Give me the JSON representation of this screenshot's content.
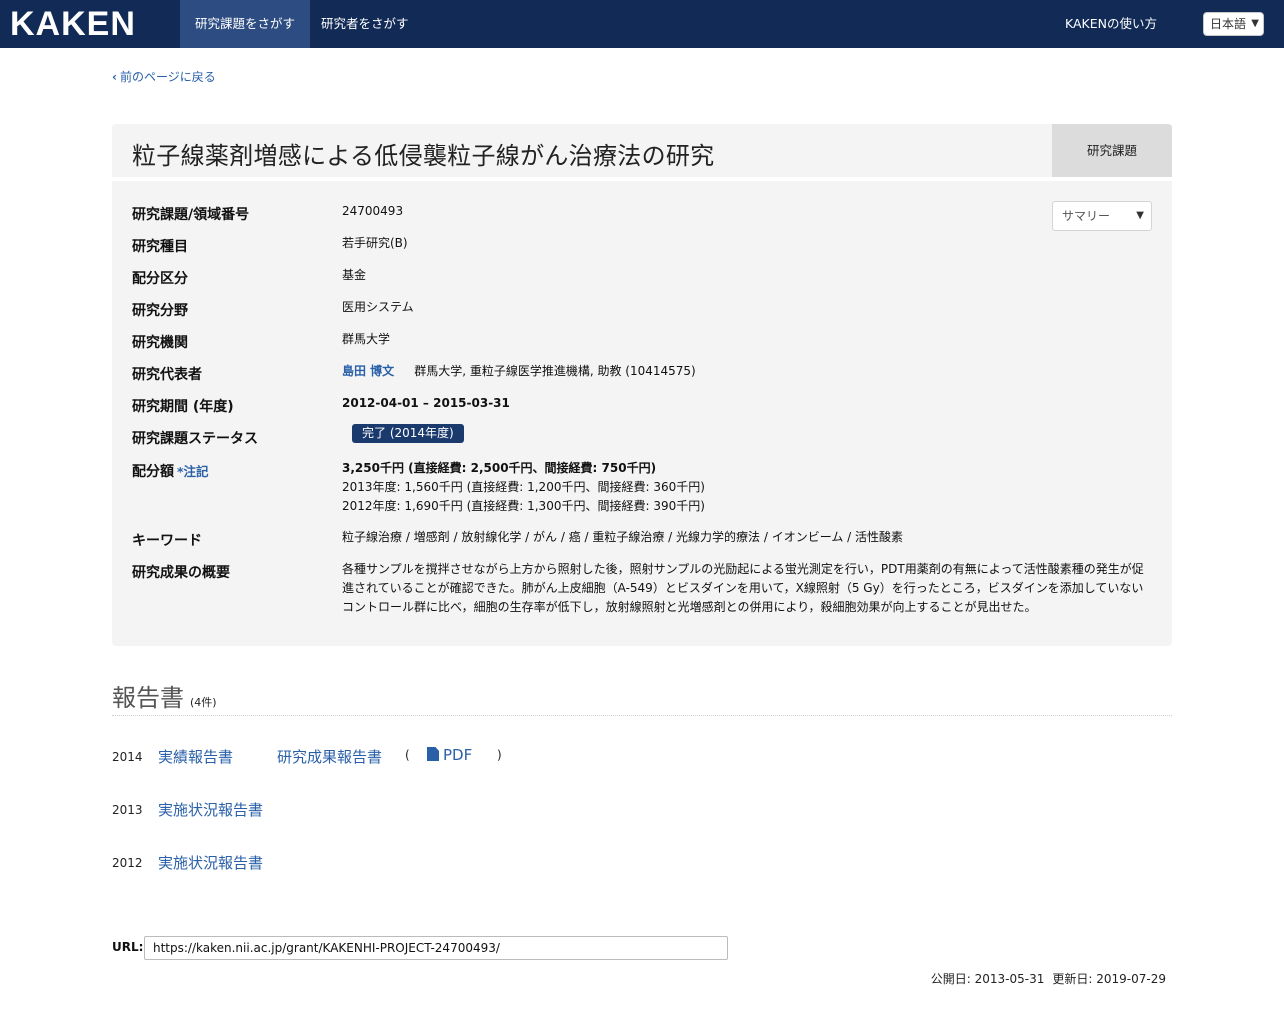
{
  "header": {
    "logo": "KAKEN",
    "nav": [
      {
        "label": "研究課題をさがす"
      },
      {
        "label": "研究者をさがす"
      }
    ],
    "help": "KAKENの使い方",
    "language": "日本語"
  },
  "back_link": "前のページに戻る",
  "project": {
    "title": "粒子線薬剤増感による低侵襲粒子線がん治療法の研究",
    "type_badge": "研究課題",
    "view_select": "サマリー",
    "fields": {
      "number": {
        "label": "研究課題/領域番号",
        "value": "24700493"
      },
      "category": {
        "label": "研究種目",
        "value": "若手研究(B)"
      },
      "allocation": {
        "label": "配分区分",
        "value": "基金"
      },
      "field": {
        "label": "研究分野",
        "value": "医用システム"
      },
      "institution": {
        "label": "研究機関",
        "value": "群馬大学"
      },
      "pi": {
        "label": "研究代表者",
        "name": "島田 博文",
        "affiliation": "群馬大学, 重粒子線医学推進機構, 助教 (10414575)"
      },
      "period": {
        "label": "研究期間 (年度)",
        "value": "2012-04-01 – 2015-03-31"
      },
      "status": {
        "label": "研究課題ステータス",
        "value": "完了 (2014年度)"
      },
      "budget": {
        "label": "配分額",
        "note": "*注記",
        "total": "3,250千円 (直接経費: 2,500千円、間接経費: 750千円)",
        "y2013": "2013年度: 1,560千円 (直接経費: 1,200千円、間接経費: 360千円)",
        "y2012": "2012年度: 1,690千円 (直接経費: 1,300千円、間接経費: 390千円)"
      },
      "keywords": {
        "label": "キーワード",
        "value": "粒子線治療 / 増感剤 / 放射線化学 / がん / 癌 / 重粒子線治療 / 光線力学的療法 / イオンビーム / 活性酸素"
      },
      "summary": {
        "label": "研究成果の概要",
        "value": "各種サンプルを撹拌させながら上方から照射した後，照射サンプルの光励起による蛍光測定を行い，PDT用薬剤の有無によって活性酸素種の発生が促進されていることが確認できた。肺がん上皮細胞（A-549）とビスダインを用いて，X線照射（5 Gy）を行ったところ，ビスダインを添加していないコントロール群に比べ，細胞の生存率が低下し，放射線照射と光増感剤との併用により，殺細胞効果が向上することが見出せた。"
      }
    }
  },
  "reports": {
    "heading": "報告書",
    "count": "(4件)",
    "rows": [
      {
        "year": "2014",
        "items": [
          "実績報告書",
          "研究成果報告書"
        ],
        "open": "(",
        "pdf": "PDF",
        "close": ")"
      },
      {
        "year": "2013",
        "items": [
          "実施状況報告書"
        ]
      },
      {
        "year": "2012",
        "items": [
          "実施状況報告書"
        ]
      }
    ]
  },
  "footer": {
    "url_label": "URL:",
    "url": "https://kaken.nii.ac.jp/grant/KAKENHI-PROJECT-24700493/",
    "published": "公開日: 2013-05-31",
    "updated": "更新日: 2019-07-29"
  }
}
